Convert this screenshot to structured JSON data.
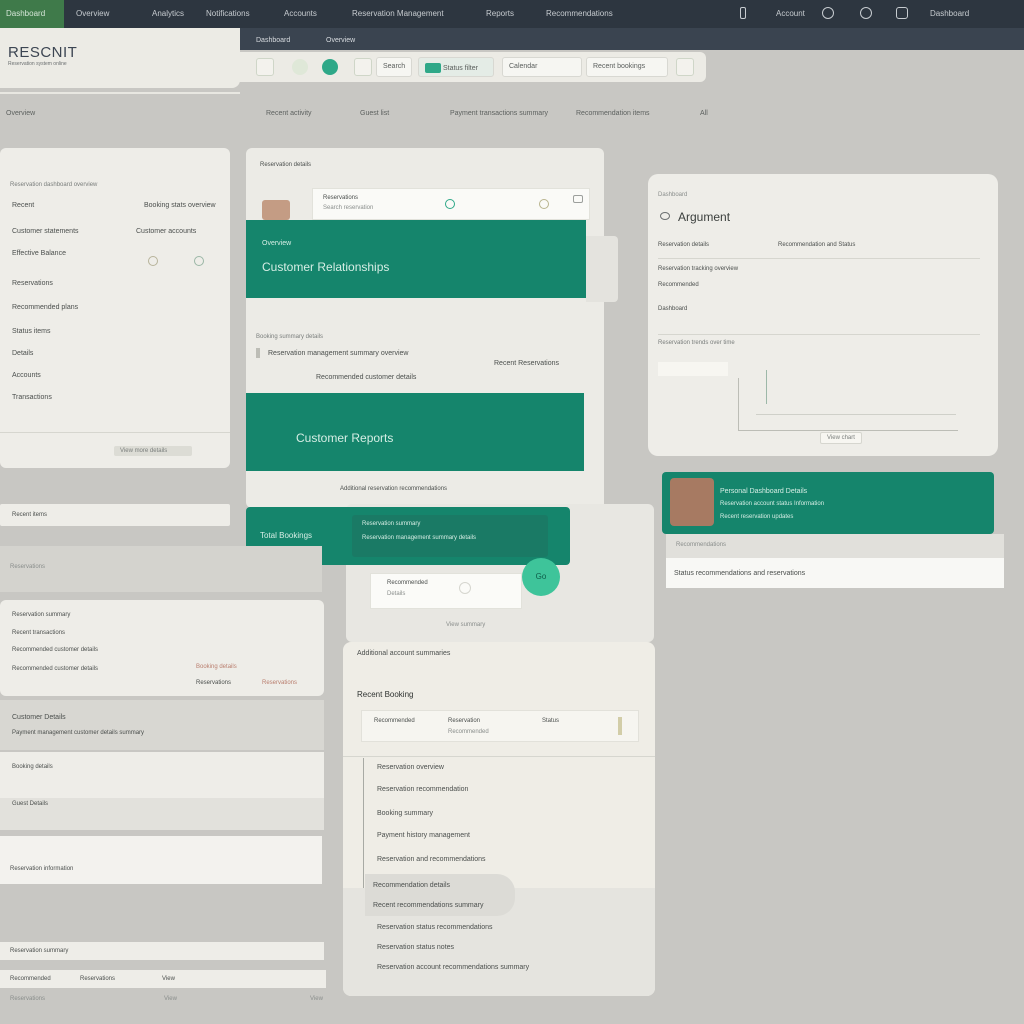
{
  "topnav": {
    "brand": "Dashboard",
    "items": [
      "Overview",
      "Analytics",
      "Notifications",
      "Accounts",
      "Reservation Management",
      "Reports",
      "Recommendations",
      "Account"
    ]
  },
  "header": {
    "logo": "RESCNIT",
    "logo_sub": "Reservation system online",
    "tabs": [
      "Dashboard",
      "Overview"
    ],
    "toolbar_labels": [
      "Search",
      "Status filter",
      "Calendar",
      "Recent bookings"
    ]
  },
  "filterbar": [
    "Overview",
    "Recent activity",
    "Guest list",
    "Payment transactions summary",
    "Recommendation items",
    "All"
  ],
  "left_panel": {
    "header": "Reservation dashboard overview",
    "rows": [
      {
        "label": "Recent",
        "value": "Booking stats overview"
      },
      {
        "label": "Customer statements",
        "value": "Customer accounts"
      },
      {
        "label": "Effective Balance"
      },
      {
        "label": "Reservations"
      },
      {
        "label": "Recommended plans"
      },
      {
        "label": "Status items"
      },
      {
        "label": "Details"
      },
      {
        "label": "Accounts"
      },
      {
        "label": "Transactions"
      }
    ],
    "footer_button": "View more details",
    "bottom_label": "Recent items"
  },
  "center_panel": {
    "header": "Reservation details",
    "search_text": "Reservations",
    "search_sub": "Search reservation",
    "band1_small": "Overview",
    "band1_title": "Customer Relationships",
    "list_header": "Booking summary details",
    "list_row": "Reservation management summary overview",
    "list_row2": "Recommended customer details",
    "right_label": "Recent Reservations",
    "band2_title": "Customer Reports",
    "footer_row": "Additional reservation recommendations",
    "band3_left": "Total Bookings",
    "band3_lines": [
      "Reservation summary",
      "Reservation management summary details"
    ],
    "popup_title": "Recommended",
    "popup_sub": "Details",
    "fab_label": "Go",
    "card_footer": "View summary"
  },
  "right_panel": {
    "title": "Argument",
    "rows": [
      "Reservation details",
      "Reservation tracking overview",
      "Recommended",
      "Dashboard"
    ],
    "header_right": "Recommendation and Status",
    "chart_caption": "Reservation trends over time",
    "button": "View chart"
  },
  "profile_card": {
    "name": "Personal Dashboard Details",
    "line2": "Reservation account status Information",
    "line3": "Recent reservation updates",
    "footer": "Recommendations",
    "footer2": "Status recommendations and reservations"
  },
  "lower_left": {
    "header": "Reservations",
    "rows": [
      "Reservation summary",
      "Recent transactions",
      "Recommended customer details"
    ],
    "row_right": "Booking details",
    "row_right2": "Reservations",
    "section2": "Customer Details",
    "section2_sub": "Payment management customer details summary",
    "section3": "Booking details",
    "section4": "Guest Details",
    "footer": "Reservation information"
  },
  "lower_center": {
    "header": "Additional account summaries",
    "title": "Recent Booking",
    "chips": [
      "Recommended",
      "Reservation",
      "Status"
    ],
    "items": [
      "Reservation overview",
      "Reservation recommendation",
      "Booking summary",
      "Payment history management",
      "Reservation and recommendations",
      "Recommendation details",
      "Recent recommendations summary",
      "Reservation status recommendations",
      "Reservation status notes",
      "Reservation account recommendations summary"
    ]
  },
  "bottom_left": {
    "row1": "Reservation summary",
    "row2_left": "Recommended",
    "row2_mid": "Reservations",
    "row2_right": "View"
  },
  "colors": {
    "teal": "#15856c",
    "nav": "#2d3640",
    "panel": "#eeede8",
    "bg": "#c8c7c3",
    "accent": "#3ec49a"
  }
}
